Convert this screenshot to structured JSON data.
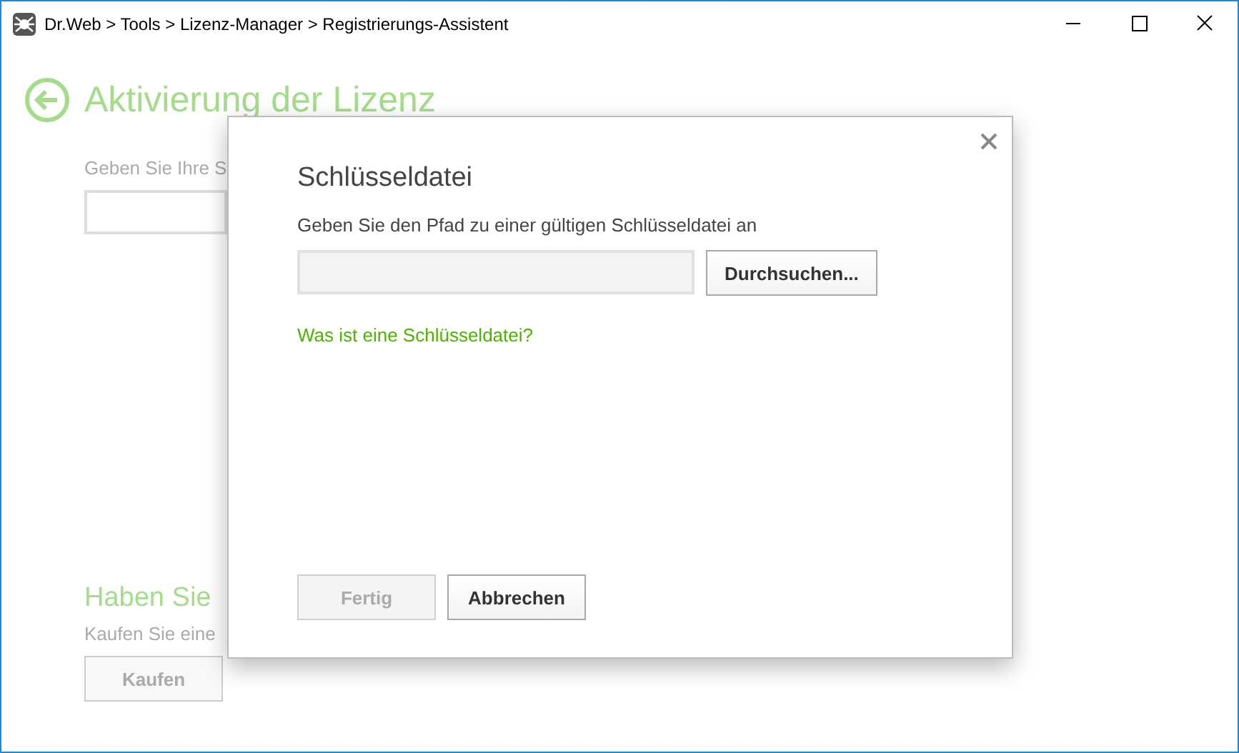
{
  "window": {
    "title": "Dr.Web > Tools > Lizenz-Manager > Registrierungs-Assistent"
  },
  "page": {
    "heading": "Aktivierung der Lizenz",
    "prompt": "Geben Sie Ihre S",
    "section_heading": "Haben Sie",
    "section_text": "Kaufen Sie eine",
    "buy_button": "Kaufen"
  },
  "dialog": {
    "title": "Schlüsseldatei",
    "instruction": "Geben Sie den Pfad zu einer gültigen Schlüsseldatei an",
    "browse_button": "Durchsuchen...",
    "help_link": "Was ist eine Schlüsseldatei?",
    "buttons": [
      {
        "label": "Fertig",
        "disabled": true
      },
      {
        "label": "Abbrechen",
        "disabled": false
      }
    ]
  }
}
